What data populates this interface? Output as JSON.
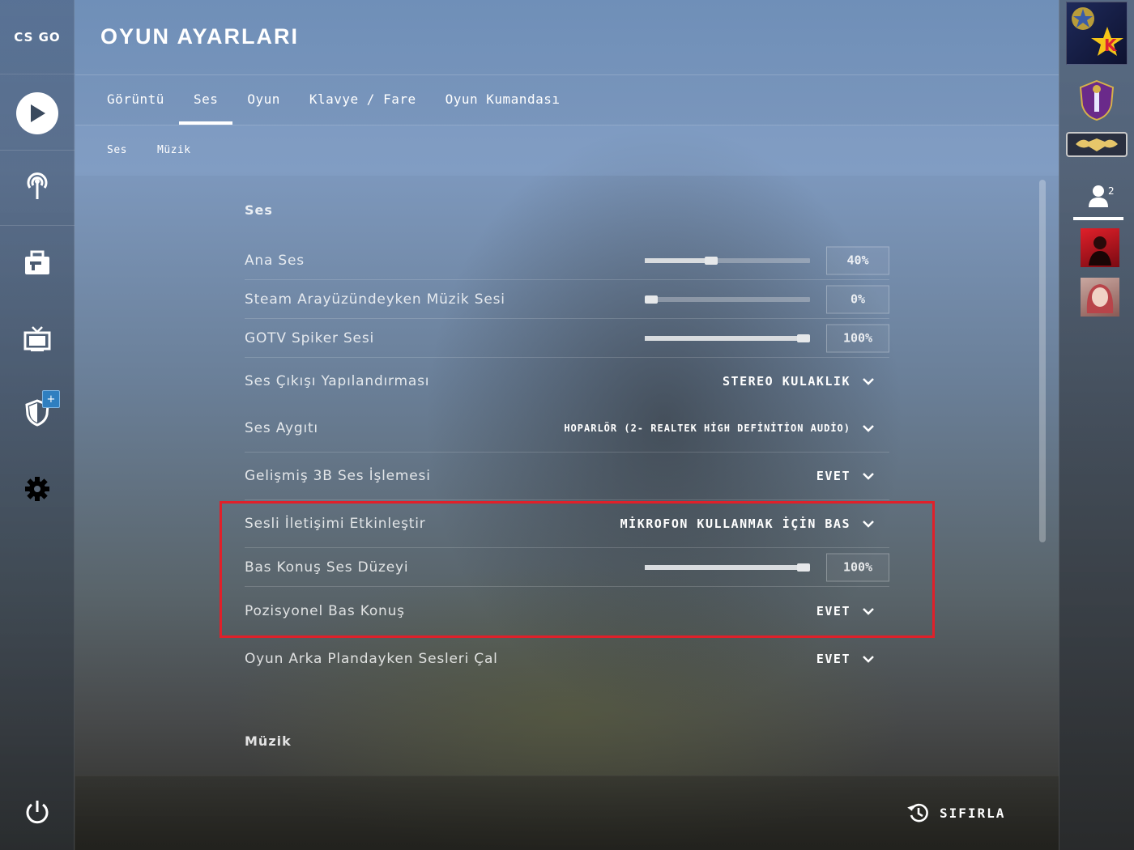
{
  "app": {
    "logo_text": "CS GO",
    "page_title": "OYUN AYARLARI"
  },
  "left_nav": {
    "items": [
      {
        "name": "play-icon"
      },
      {
        "name": "broadcast-icon"
      },
      {
        "name": "inventory-icon"
      },
      {
        "name": "tv-icon"
      },
      {
        "name": "shield-icon",
        "badge": "+"
      },
      {
        "name": "gear-icon"
      }
    ],
    "power_icon": "power-icon"
  },
  "tabs": [
    {
      "label": "Görüntü",
      "active": false
    },
    {
      "label": "Ses",
      "active": true
    },
    {
      "label": "Oyun",
      "active": false
    },
    {
      "label": "Klavye / Fare",
      "active": false
    },
    {
      "label": "Oyun Kumandası",
      "active": false
    }
  ],
  "subtabs": [
    {
      "label": "Ses"
    },
    {
      "label": "Müzik"
    }
  ],
  "sections": {
    "sound_title": "Ses",
    "music_title": "Müzik"
  },
  "settings": [
    {
      "label": "Ana Ses",
      "type": "slider",
      "value": 0.4,
      "value_text": "40%"
    },
    {
      "label": "Steam Arayüzündeyken Müzik Sesi",
      "type": "slider",
      "value": 0.0,
      "value_text": "0%"
    },
    {
      "label": "GOTV Spiker Sesi",
      "type": "slider",
      "value": 1.0,
      "value_text": "100%"
    },
    {
      "label": "Ses Çıkışı Yapılandırması",
      "type": "dropdown",
      "value_text": "STEREO KULAKLIK"
    },
    {
      "label": "Ses Aygıtı",
      "type": "dropdown",
      "value_text": "HOPARLÖR (2- REALTEK HİGH DEFİNİTİON AUDİO)"
    },
    {
      "label": "Gelişmiş 3B Ses İşlemesi",
      "type": "dropdown",
      "value_text": "EVET"
    },
    {
      "label": "Sesli İletişimi Etkinleştir",
      "type": "dropdown",
      "value_text": "MİKROFON KULLANMAK İÇİN BAS"
    },
    {
      "label": "Bas Konuş Ses Düzeyi",
      "type": "slider",
      "value": 1.0,
      "value_text": "100%"
    },
    {
      "label": "Pozisyonel Bas Konuş",
      "type": "dropdown",
      "value_text": "EVET"
    },
    {
      "label": "Oyun Arka Plandayken Sesleri Çal",
      "type": "dropdown",
      "value_text": "EVET"
    }
  ],
  "footer": {
    "reset_label": "SIFIRLA",
    "reset_icon": "history-icon"
  },
  "right_panel": {
    "friend_count": "2",
    "friends_icon": "friends-icon"
  },
  "colors": {
    "highlight": "#e0202a",
    "accent": "#ffffff"
  }
}
